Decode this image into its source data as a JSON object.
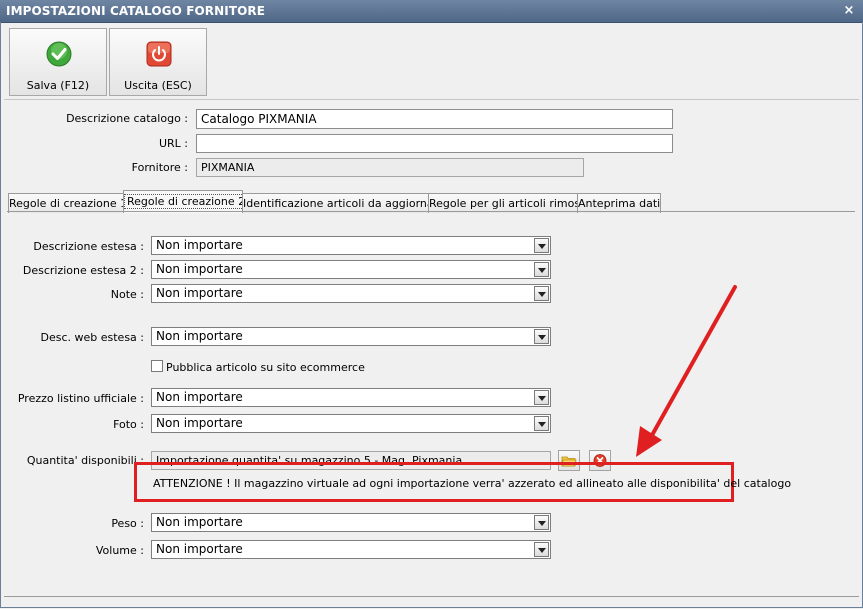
{
  "window": {
    "title": "IMPOSTAZIONI CATALOGO FORNITORE",
    "close_glyph": "×"
  },
  "toolbar": {
    "save_label": "Salva (F12)",
    "exit_label": "Uscita (ESC)"
  },
  "header_form": {
    "descrizione_label": "Descrizione catalogo :",
    "descrizione_value": "Catalogo PIXMANIA",
    "url_label": "URL :",
    "url_value": "",
    "fornitore_label": "Fornitore :",
    "fornitore_value": "PIXMANIA"
  },
  "tabs": [
    {
      "label": "Regole di creazione 1",
      "active": false
    },
    {
      "label": "Regole di creazione 2",
      "active": true
    },
    {
      "label": "Identificazione articoli da aggiornare",
      "active": false
    },
    {
      "label": "Regole per gli articoli rimossi",
      "active": false
    },
    {
      "label": "Anteprima dati",
      "active": false
    }
  ],
  "fields": {
    "desc_estesa": {
      "label": "Descrizione estesa :",
      "value": "Non importare"
    },
    "desc_estesa2": {
      "label": "Descrizione estesa 2 :",
      "value": "Non importare"
    },
    "note": {
      "label": "Note :",
      "value": "Non importare"
    },
    "desc_web": {
      "label": "Desc. web estesa :",
      "value": "Non importare"
    },
    "pubblica": {
      "label": "Pubblica articolo su sito ecommerce",
      "checked": false
    },
    "prezzo": {
      "label": "Prezzo listino ufficiale :",
      "value": "Non importare"
    },
    "foto": {
      "label": "Foto :",
      "value": "Non importare"
    },
    "quantita": {
      "label": "Quantita' disponibili :",
      "value": "Importazione quantita' su magazzino 5 - Mag. Pixmania"
    },
    "peso": {
      "label": "Peso :",
      "value": "Non importare"
    },
    "volume": {
      "label": "Volume :",
      "value": "Non importare"
    }
  },
  "warning": "ATTENZIONE ! Il magazzino virtuale ad ogni importazione verra' azzerato ed allineato alle disponibilita' del catalogo",
  "colors": {
    "annotation": "#e02020",
    "titlebar": "#5a7190"
  }
}
